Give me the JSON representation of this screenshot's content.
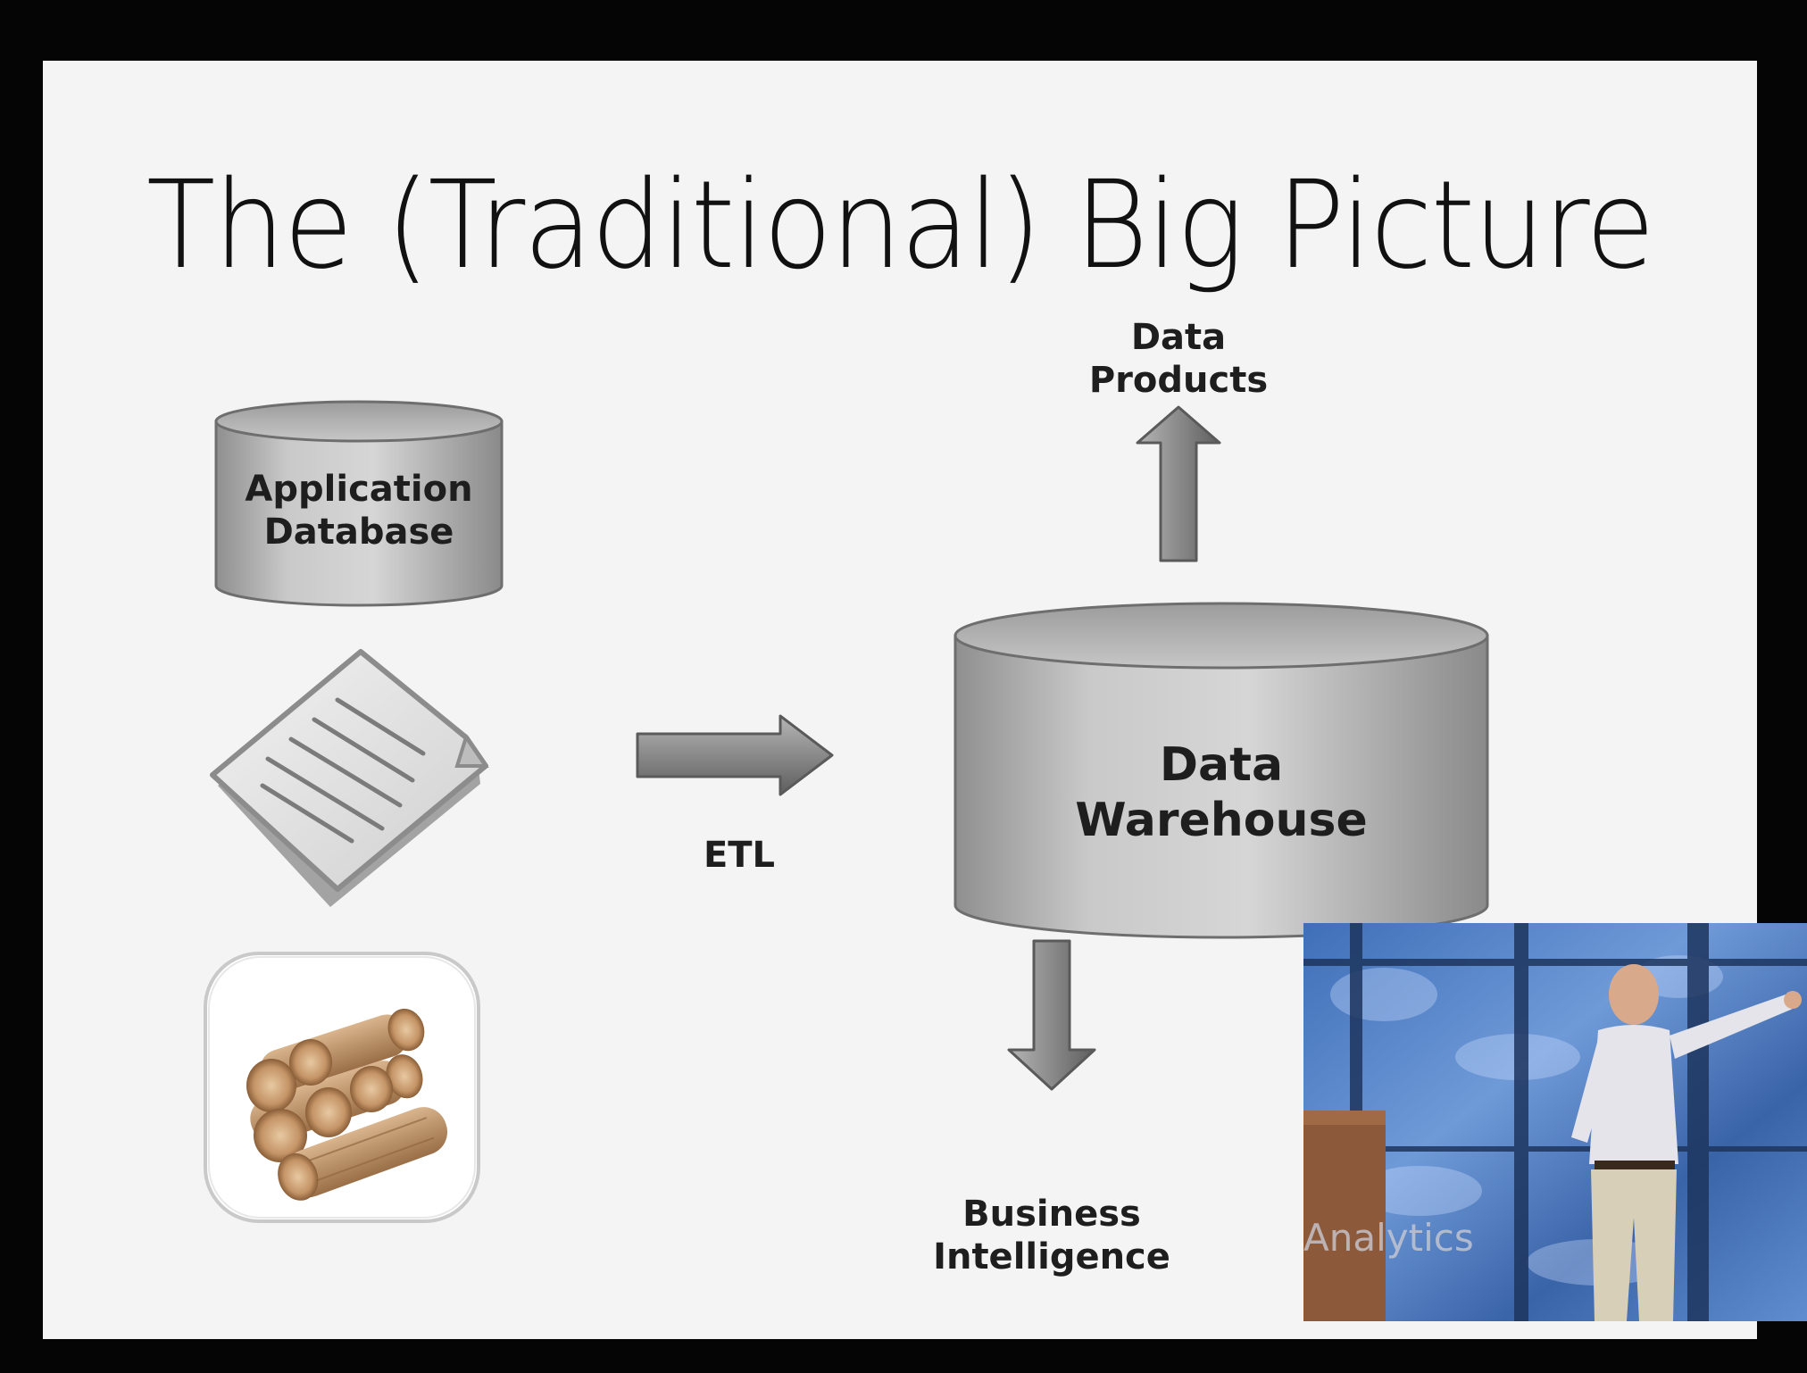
{
  "slide": {
    "title": "The (Traditional) Big Picture"
  },
  "diagram": {
    "sources": {
      "application_database": "Application\nDatabase",
      "document_icon": "document-icon",
      "logs_icon": "logs-icon"
    },
    "etl_label": "ETL",
    "warehouse_label": "Data\nWarehouse",
    "outputs": {
      "data_products": "Data\nProducts",
      "business_intelligence": "Business\nIntelligence"
    }
  },
  "video_overlay": {
    "text": "Analytics"
  },
  "colors": {
    "background": "#050505",
    "slide": "#f4f4f4",
    "cylinder": "#b8b8b8",
    "arrow": "#8e8e8e",
    "video_blue": "#4f7fc8"
  }
}
